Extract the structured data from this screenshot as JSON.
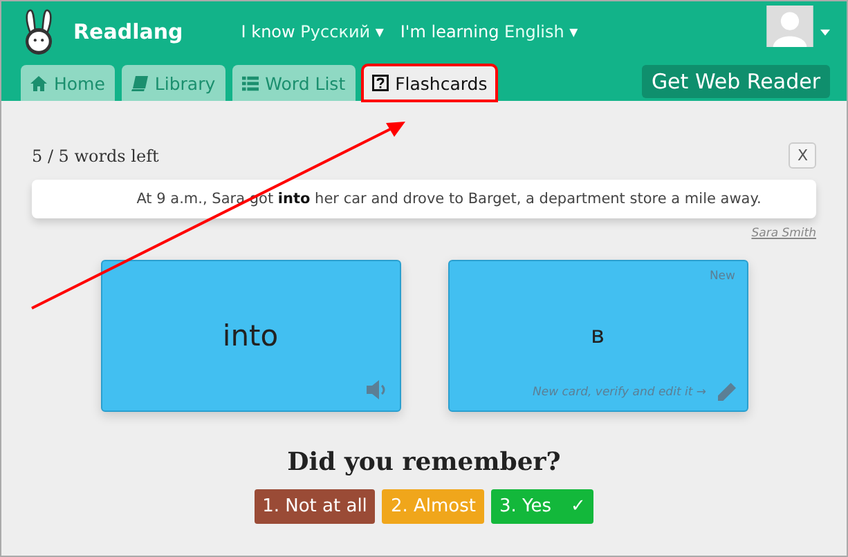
{
  "header": {
    "app_name": "Readlang",
    "know_label": "I know",
    "know_language": "Русский",
    "learning_label": "I'm learning",
    "learning_language": "English"
  },
  "dropdown_caret": "▾",
  "tabs": [
    {
      "label": "Home",
      "selected": false,
      "highlighted": false
    },
    {
      "label": "Library",
      "selected": false,
      "highlighted": false
    },
    {
      "label": "Word List",
      "selected": false,
      "highlighted": false
    },
    {
      "label": "Flashcards",
      "selected": true,
      "highlighted": true
    }
  ],
  "web_reader_button": "Get Web Reader",
  "progress": "5 / 5 words left",
  "close_button": "X",
  "sentence": "At 9 a.m., Sara got **into** her car and drove to Barget, a department store a mile away.",
  "source": "Sara Smith",
  "front_card": {
    "word": "into"
  },
  "back_card": {
    "badge": "New",
    "translation": "в",
    "hint": "New card, verify and edit it →"
  },
  "question": "Did you remember?",
  "answers": [
    {
      "label": "1. Not at all",
      "color": "#9a4b36"
    },
    {
      "label": "2. Almost",
      "color": "#f0a61b"
    },
    {
      "label": "3. Yes",
      "color": "#13b83b",
      "checkmark": "✓"
    }
  ],
  "annotation_arrow": true
}
